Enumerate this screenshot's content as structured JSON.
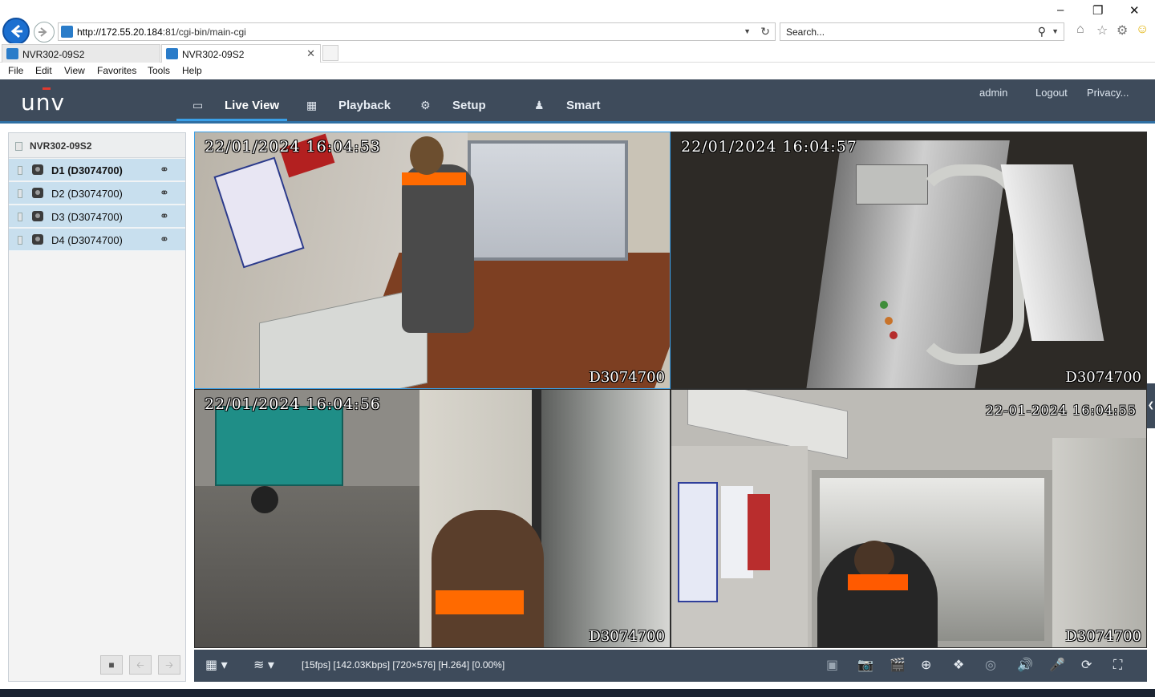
{
  "browser": {
    "url_prefix": "http://172.55.20.184",
    "url_suffix": ":81/cgi-bin/main-cgi",
    "search_placeholder": "Search...",
    "tabs": [
      {
        "label": "NVR302-09S2",
        "active": false
      },
      {
        "label": "NVR302-09S2",
        "active": true
      }
    ],
    "menu": [
      "File",
      "Edit",
      "View",
      "Favorites",
      "Tools",
      "Help"
    ],
    "window_controls": {
      "minimize": "–",
      "restore": "❐",
      "close": "✕"
    }
  },
  "app": {
    "logo": "unv",
    "nav": [
      {
        "label": "Live View",
        "icon": "monitor-icon",
        "active": true
      },
      {
        "label": "Playback",
        "icon": "film-icon",
        "active": false
      },
      {
        "label": "Setup",
        "icon": "gear-icon",
        "active": false
      },
      {
        "label": "Smart",
        "icon": "person-icon",
        "active": false
      }
    ],
    "header_links": {
      "user": "admin",
      "logout": "Logout",
      "privacy": "Privacy..."
    },
    "accent_color": "#3aa0e8",
    "header_color": "#3e4b5b"
  },
  "device_tree": {
    "root": "NVR302-09S2",
    "channels": [
      {
        "label": "D1 (D3074700)",
        "selected": true
      },
      {
        "label": "D2 (D3074700)",
        "selected": false
      },
      {
        "label": "D3 (D3074700)",
        "selected": false
      },
      {
        "label": "D4 (D3074700)",
        "selected": false
      }
    ]
  },
  "video_tiles": [
    {
      "timestamp": "22/01/2024  16:04:53",
      "camera": "D3074700",
      "selected": true
    },
    {
      "timestamp": "22/01/2024  16:04:57",
      "camera": "D3074700",
      "selected": false
    },
    {
      "timestamp": "22/01/2024  16:04:56",
      "camera": "D3074700",
      "selected": false
    },
    {
      "timestamp": "22-01-2024  16:04:55",
      "camera": "D3074700",
      "selected": false
    }
  ],
  "toolbar": {
    "stream_info": "[15fps] [142.03Kbps] [720×576] [H.264] [0.00%]",
    "icons": [
      "layout-grid-icon",
      "stream-select-icon",
      "sequence-icon",
      "snapshot-icon",
      "record-clip-icon",
      "digital-zoom-icon",
      "ptz-icon",
      "fisheye-icon",
      "volume-icon",
      "talk-icon",
      "3d-zoom-icon",
      "fullscreen-icon"
    ]
  }
}
